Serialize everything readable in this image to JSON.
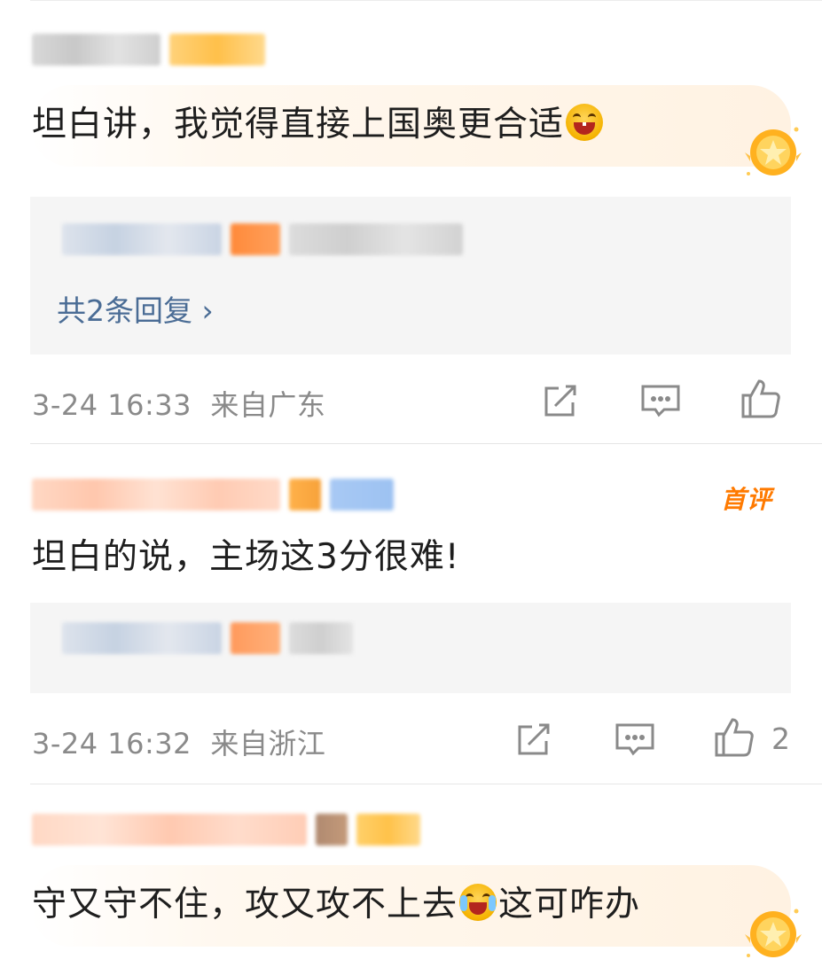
{
  "comments": [
    {
      "text": "坦白讲，我觉得直接上国奥更合适",
      "emoji": "grinning-face-icon",
      "has_medal": true,
      "reply_link": "共2条回复 ›",
      "time": "3-24 16:33",
      "location": "来自广东",
      "like_count": ""
    },
    {
      "text": "坦白的说，主场这3分很难!",
      "badge": "首评",
      "time": "3-24 16:32",
      "location": "来自浙江",
      "like_count": "2"
    },
    {
      "text_before_emoji": "守又守不住，攻又攻不上去",
      "emoji": "crying-laughing-face-icon",
      "text_after_emoji": "这可咋办",
      "has_medal": true
    }
  ],
  "colors": {
    "reply_link": "#4a6c95",
    "meta_text": "#8a8a8a",
    "first_comment_badge": "#ff7a00",
    "bubble_tint": "#fff2e2",
    "reply_box_bg": "#f5f5f5"
  }
}
